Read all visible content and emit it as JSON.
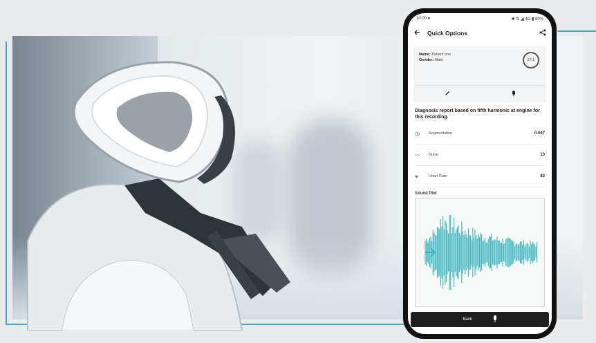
{
  "status_bar": {
    "time": "10:00 ●",
    "indicators": "✱ ⇅ ◢ 4G ▮ 80%"
  },
  "app_bar": {
    "title": "Quick Options",
    "back_icon": "back-arrow-icon",
    "share_icon": "share-icon"
  },
  "info_card": {
    "name_label": "Name:",
    "name_value": "Patient one",
    "gender_label": "Gender:",
    "gender_value": "Male",
    "gauge_value": "27.1"
  },
  "tools": {
    "edit_icon": "pencil-icon",
    "record_icon": "microphone-icon"
  },
  "question": "Diagnosis report based on fifth harmonic at engine for this recording.",
  "metrics": [
    {
      "icon": "clock-icon",
      "label": "Segmentation",
      "value": "0.047"
    },
    {
      "icon": "wave-icon",
      "label": "Noise",
      "value": "13"
    },
    {
      "icon": "heart-icon",
      "label": "Heart Rate",
      "value": "83"
    }
  ],
  "plot": {
    "label": "Sound Plot",
    "color": "#35b3bd"
  },
  "bottom_button": {
    "label": "Back",
    "icon": "mic-icon"
  },
  "accent_color": "#3fb0c6"
}
